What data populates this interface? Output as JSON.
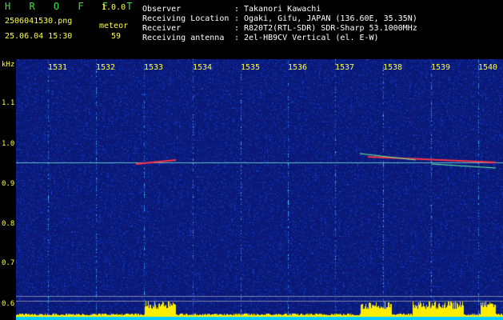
{
  "app": {
    "name": "H R O F F T",
    "version": "1.0.0"
  },
  "file": {
    "name": "2506041530.png",
    "timestamp": "25.06.04 15:30"
  },
  "meteor": {
    "label": "meteor",
    "count": "59"
  },
  "info": [
    {
      "key": "Observer",
      "sep": ":",
      "value": "Takanori Kawachi"
    },
    {
      "key": "Receiving Location",
      "sep": ":",
      "value": "Ogaki, Gifu, JAPAN (136.60E, 35.35N)"
    },
    {
      "key": "Receiver",
      "sep": ":",
      "value": "R820T2(RTL-SDR) SDR-Sharp 53.1000MHz"
    },
    {
      "key": "Receiving antenna",
      "sep": ":",
      "value": "2el-HB9CV Vertical (el. E-W)"
    }
  ],
  "yaxis": {
    "unit": "kHz",
    "ticks": [
      "1.1",
      "1.0",
      "0.9",
      "0.8",
      "0.7",
      "0.6"
    ]
  },
  "xaxis": {
    "ticks": [
      "1531",
      "1532",
      "1533",
      "1534",
      "1535",
      "1536",
      "1537",
      "1538",
      "1539",
      "1540"
    ]
  },
  "colors": {
    "background": "#0a1a7a",
    "text": "#ffffff",
    "title": "#3fe03f",
    "axis": "#ffff44",
    "meteor": "#ff4444",
    "bottom_bar": "#00ccff"
  }
}
